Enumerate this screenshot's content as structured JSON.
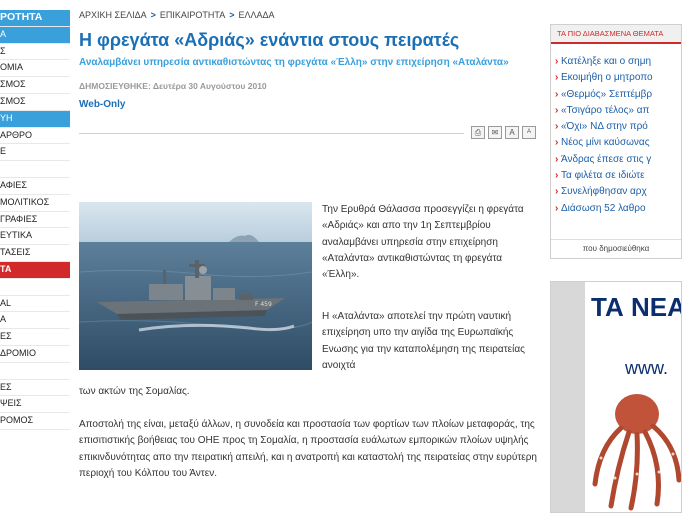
{
  "left_nav": {
    "header": "ΡΟΤΗΤΑ",
    "items": [
      {
        "label": "Α",
        "style": "blue"
      },
      {
        "label": "Σ",
        "style": ""
      },
      {
        "label": "ΟΜΙΑ",
        "style": ""
      },
      {
        "label": "ΣΜΟΣ",
        "style": ""
      },
      {
        "label": "ΣΜΟΣ",
        "style": ""
      },
      {
        "label": "ΥΗ",
        "style": "blue"
      },
      {
        "label": "ΑΡΘΡΟ",
        "style": ""
      },
      {
        "label": "Ε",
        "style": ""
      },
      {
        "label": "",
        "style": ""
      },
      {
        "label": "ΑΦΙΕΣ",
        "style": ""
      },
      {
        "label": "ΜΟΛΙΤΙΚΟΣ",
        "style": ""
      },
      {
        "label": "ΓΡΑΦΙΕΣ",
        "style": ""
      },
      {
        "label": "ΕΥΤΙΚΑ",
        "style": ""
      },
      {
        "label": "ΤΑΣΕΙΣ",
        "style": ""
      },
      {
        "label": "ΤΑ",
        "style": "red"
      },
      {
        "label": "",
        "style": ""
      },
      {
        "label": "AL",
        "style": ""
      },
      {
        "label": "Α",
        "style": ""
      },
      {
        "label": "ΕΣ",
        "style": ""
      },
      {
        "label": "ΔΡΟΜΙΟ",
        "style": ""
      },
      {
        "label": "",
        "style": ""
      },
      {
        "label": "ΕΣ",
        "style": ""
      },
      {
        "label": "ΨΕΙΣ",
        "style": ""
      },
      {
        "label": "ΡΟΜΟΣ",
        "style": ""
      }
    ]
  },
  "breadcrumb": {
    "home": "ΑΡΧΙΚΗ ΣΕΛΙΔΑ",
    "sep": ">",
    "section": "ΕΠΙΚΑΙΡΟΤΗΤΑ",
    "subsection": "ΕΛΛΑΔΑ"
  },
  "article": {
    "title": "Η φρεγάτα «Αδριάς» ενάντια στους πειρατές",
    "subtitle": "Αναλαμβάνει υπηρεσία αντικαθιστώντας τη φρεγάτα «Έλλη» στην επιχείρηση «Αταλάντα»",
    "published": "ΔΗΜΟΣΙΕΥΘΗΚΕ: Δευτέρα 30 Αυγούστου 2010",
    "label": "Web-Only",
    "p1": "Την Ερυθρά Θάλασσα προσεγγίζει η φρεγάτα «Αδριάς» και απο την 1η Σεπτεμβρίου αναλαμβάνει υπηρεσία στην επιχείρηση «Αταλάντα» αντικαθιστώντας τη φρεγάτα «Έλλη».",
    "p2": "Η «Αταλάντα» αποτελεί την πρώτη ναυτική επιχείρηση υπο την αιγίδα της Ευρωπαϊκής Ενωσης για την καταπολέμηση της πειρατείας ανοιχτά",
    "p2_tail": "των ακτών της Σομαλίας.",
    "p3": "Αποστολή της είναι, μεταξύ άλλων, η συνοδεία και προστασία των φορτίων των πλοίων μεταφοράς, της επισιτιστικής βοήθειας του ΟΗΕ προς τη Σομαλία, η προστασία ευάλωτων εμπορικών πλοίων υψηλής επικινδυνότητας απο την πειρατική απειλή, και η ανατροπή και καταστολή της πειρατείας στην ευρύτερη περιοχή του Κόλπου του Άντεν."
  },
  "tools": {
    "print": "⎙",
    "email": "✉",
    "font_up": "A",
    "font_down": "A"
  },
  "most_read": {
    "title": "ΤΑ ΠΙΟ ΔΙΑΒΑΣΜΕΝΑ ΘΕΜΑΤΑ",
    "items": [
      "Κατέληξε και ο σημη",
      "Εκοιμήθη ο μητροπο",
      "«Θερμός» Σεπτέμβρ",
      "«Τσιγάρο τέλος» απ",
      "«Όχι» ΝΔ στην πρό",
      "Νέος μίνι καύσωνας",
      "Άνδρας έπεσε στις γ",
      "Τα φιλέτα σε ιδιώτε",
      "Συνελήφθησαν αρχ",
      "Διάσωση 52 λαθρο"
    ],
    "footer": "που δημοσιεύθηκα"
  },
  "ad": {
    "title": "ΤΑ ΝΕΑ",
    "url": "www."
  },
  "colors": {
    "accent_blue": "#3aa0dc",
    "title_blue": "#1b6fb5",
    "red": "#d12a2a"
  }
}
